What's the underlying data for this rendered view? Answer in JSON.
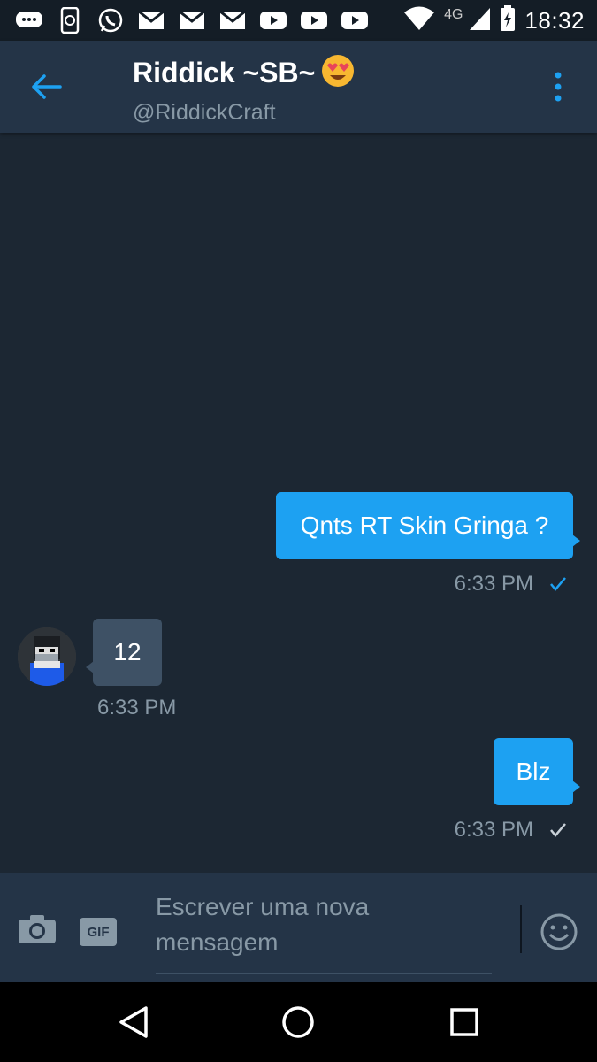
{
  "status_bar": {
    "network": "4G",
    "time": "18:32",
    "icons": [
      "chat-icon",
      "phone-sync-icon",
      "whatsapp-icon",
      "gmail-icon",
      "gmail-icon",
      "gmail-icon",
      "youtube-icon",
      "youtube-icon",
      "youtube-icon",
      "wifi-icon",
      "signal-icon",
      "battery-icon"
    ]
  },
  "header": {
    "title": "Riddick ~SB~",
    "title_emoji": "heart-eyes-emoji",
    "handle": "@RiddickCraft",
    "back_icon": "arrow-left-icon",
    "menu_icon": "more-vertical-icon",
    "accent": "#1da1f2"
  },
  "messages": [
    {
      "direction": "outgoing",
      "text": "Qnts RT Skin Gringa ?",
      "time": "6:33 PM",
      "status": "read-check"
    },
    {
      "direction": "incoming",
      "text": "12",
      "time": "6:33 PM"
    },
    {
      "direction": "outgoing",
      "text": "Blz",
      "time": "6:33 PM",
      "status": "sent-check"
    }
  ],
  "composer": {
    "placeholder_line1": "Escrever uma nova",
    "placeholder_line2": "mensagem",
    "gif_label": "GIF",
    "camera_icon": "camera-icon",
    "emoji_icon": "smiley-icon"
  },
  "nav_bar": {
    "icons": [
      "back-triangle-icon",
      "home-circle-icon",
      "recents-square-icon"
    ]
  },
  "colors": {
    "background": "#1c2733",
    "app_bar": "#243447",
    "outgoing_bubble": "#1da1f2",
    "incoming_bubble": "#3e5165",
    "muted_text": "#8899a6"
  }
}
